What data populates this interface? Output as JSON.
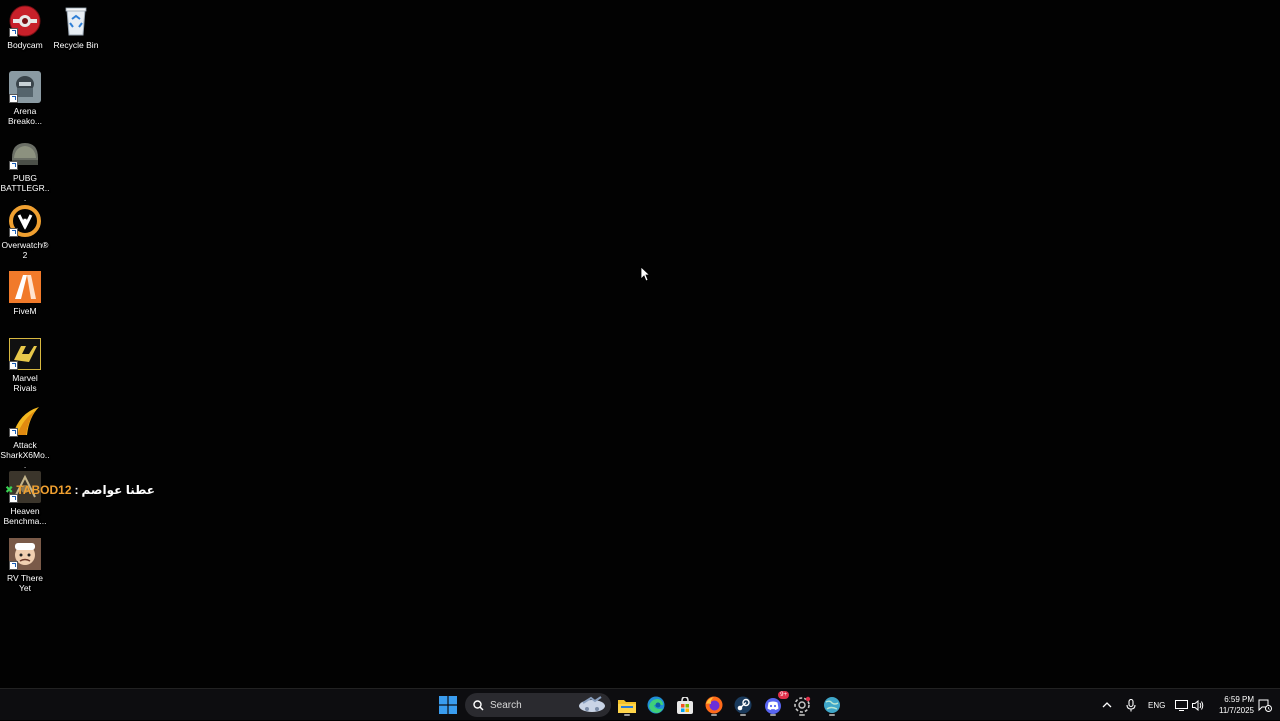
{
  "desktop": {
    "icons": [
      {
        "name": "bodycam-icon",
        "label": "Bodycam"
      },
      {
        "name": "recycle-bin-icon",
        "label": "Recycle Bin"
      },
      {
        "name": "arena-breakout-icon",
        "label": "Arena Breako..."
      },
      {
        "name": "pubg-icon",
        "label": "PUBG BATTLEGR..."
      },
      {
        "name": "overwatch-icon",
        "label": "Overwatch® 2"
      },
      {
        "name": "fivem-icon",
        "label": "FiveM"
      },
      {
        "name": "marvel-rivals-icon",
        "label": "Marvel Rivals"
      },
      {
        "name": "attack-shark-icon",
        "label": "Attack SharkX6Mo..."
      },
      {
        "name": "heaven-benchmark-icon",
        "label": "Heaven Benchma..."
      },
      {
        "name": "rv-there-yet-icon",
        "label": "RV There Yet"
      }
    ],
    "overlay": {
      "name_text": "TABOD12",
      "separator": ":",
      "arabic_text": "عطنا عواصم"
    }
  },
  "taskbar": {
    "search_label": "Search",
    "apps": [
      {
        "name": "start-button",
        "icon": "windows-logo-icon"
      },
      {
        "name": "file-explorer-button",
        "icon": "folder-icon"
      },
      {
        "name": "edge-button",
        "icon": "edge-icon"
      },
      {
        "name": "store-button",
        "icon": "store-icon"
      },
      {
        "name": "firefox-button",
        "icon": "firefox-icon"
      },
      {
        "name": "steam-button",
        "icon": "steam-icon"
      },
      {
        "name": "discord-button",
        "icon": "discord-icon",
        "badge": "9+"
      },
      {
        "name": "chrome-like-button",
        "icon": "settings-app-icon"
      },
      {
        "name": "network-app-button",
        "icon": "globe-icon"
      }
    ],
    "tray": {
      "language": "ENG",
      "time": "6:59 PM",
      "date": "11/7/2025"
    }
  },
  "colors": {
    "desktop_background": "#020202",
    "taskbar_background": "#0d0d10",
    "windows_blue": "#3a9df0",
    "accent_orange": "#f0a030"
  }
}
